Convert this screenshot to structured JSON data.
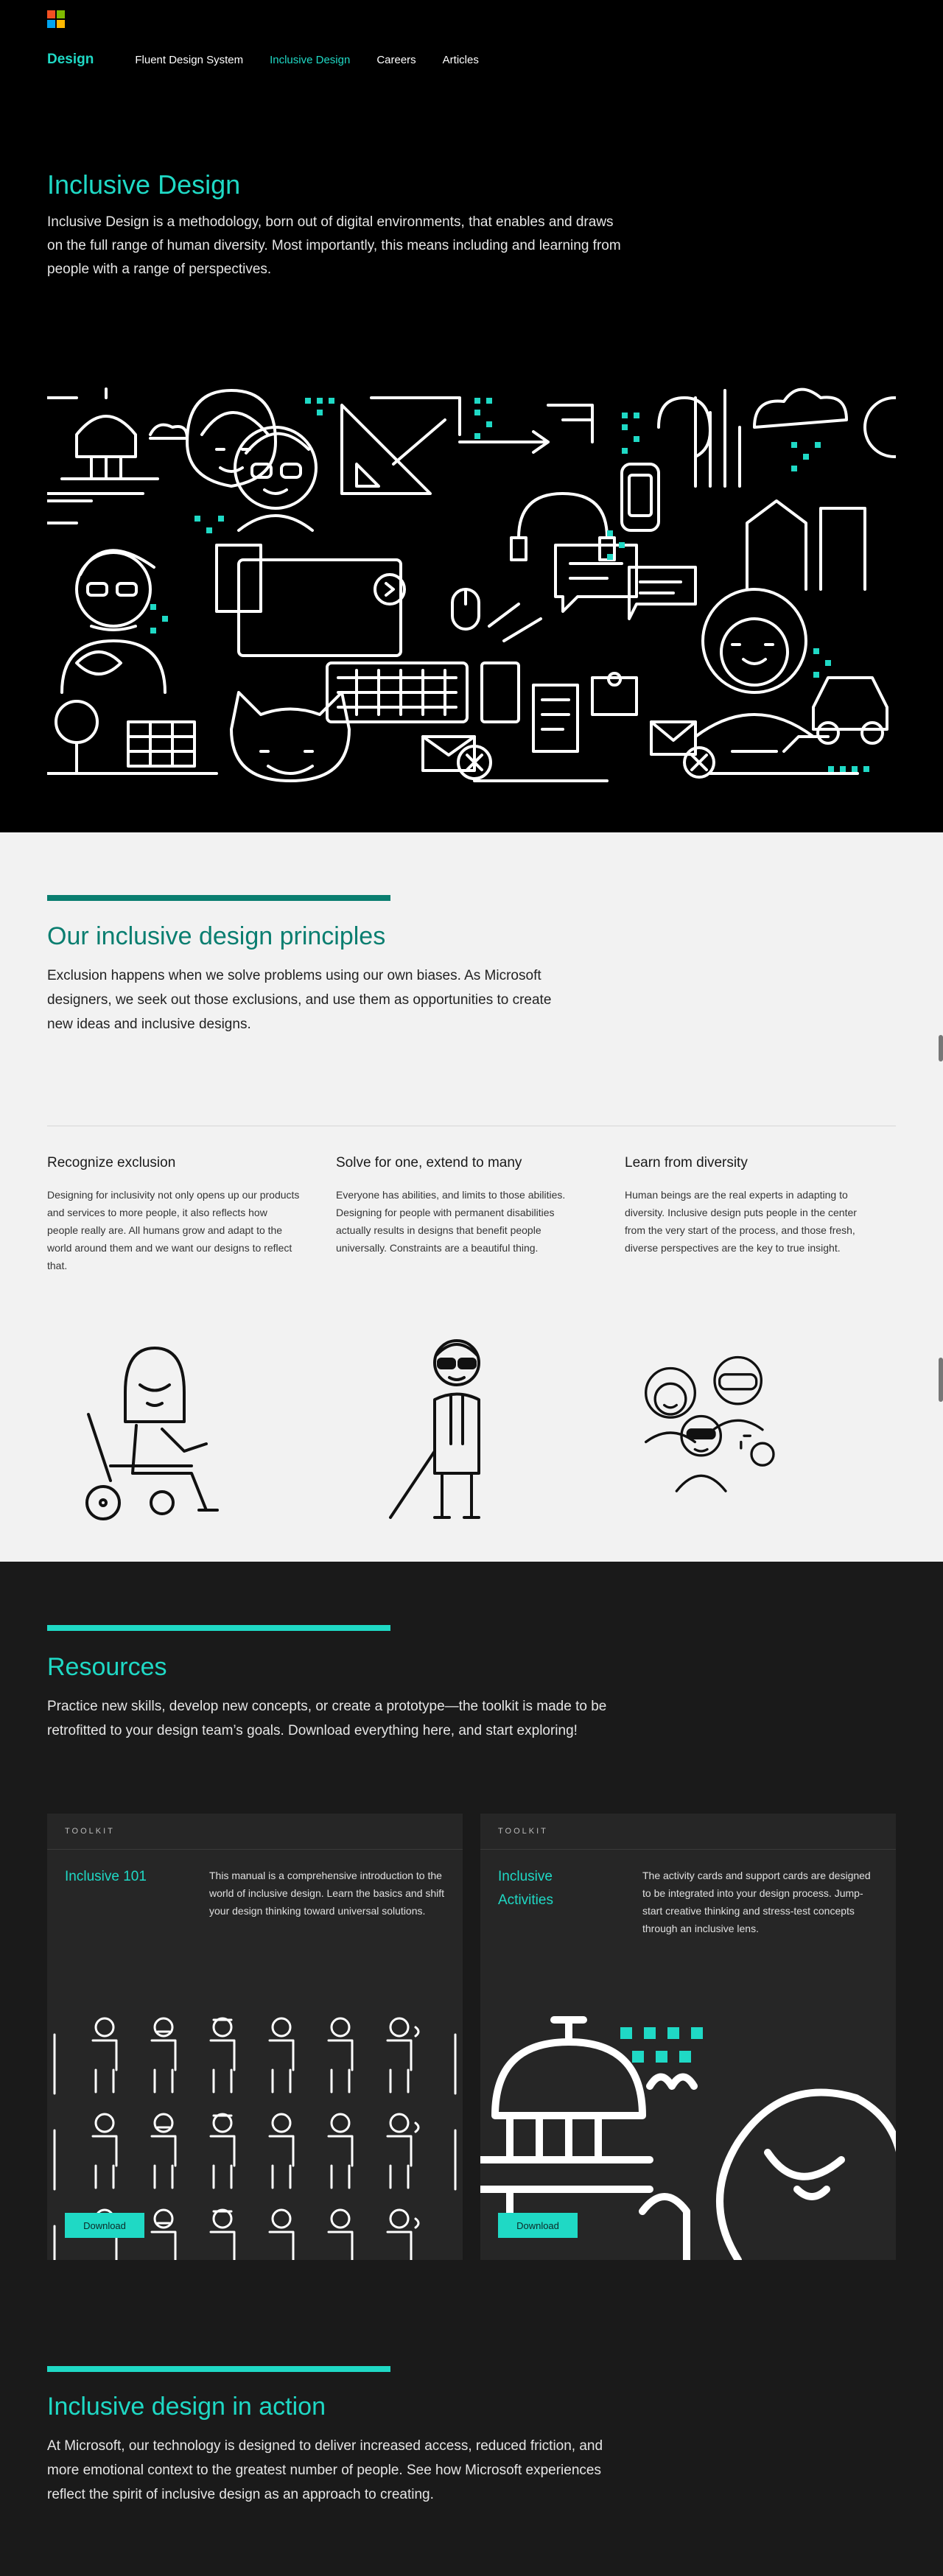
{
  "logo": {
    "colors": [
      "#f25022",
      "#7fba00",
      "#00a4ef",
      "#ffb900"
    ],
    "name": "microsoft-logo"
  },
  "nav": {
    "brand": "Design",
    "items": [
      {
        "label": "Fluent Design System",
        "active": false
      },
      {
        "label": "Inclusive Design",
        "active": true
      },
      {
        "label": "Careers",
        "active": false
      },
      {
        "label": "Articles",
        "active": false
      }
    ]
  },
  "hero": {
    "title": "Inclusive Design",
    "body": "Inclusive Design is a methodology, born out of digital environments, that enables and draws on the full range of human diversity. Most importantly, this means including and learning from people with a range of perspectives."
  },
  "principles": {
    "title": "Our inclusive design principles",
    "intro": "Exclusion happens when we solve problems using our own biases. As Microsoft designers, we seek out those exclusions, and use them as opportunities to create new ideas and inclusive designs.",
    "items": [
      {
        "title": "Recognize exclusion",
        "body": "Designing for inclusivity not only opens up our products and services to more people, it also reflects how people really are. All humans grow and adapt to the world around them and we want our designs to reflect that."
      },
      {
        "title": "Solve for one, extend to many",
        "body": "Everyone has abilities, and limits to those abilities. Designing for people with permanent disabilities actually results in designs that benefit people universally. Constraints are a beautiful thing."
      },
      {
        "title": "Learn from diversity",
        "body": "Human beings are the real experts in adapting to diversity. Inclusive design puts people in the center from the very start of the process, and those fresh, diverse perspectives are the key to true insight."
      }
    ]
  },
  "resources": {
    "title": "Resources",
    "intro": "Practice new skills, develop new concepts, or create a prototype—the toolkit is made to be retrofitted to your design team’s goals. Download everything here, and start exploring!",
    "cards": [
      {
        "kicker": "TOOLKIT",
        "title": "Inclusive 101",
        "body": "This manual is a comprehensive introduction to the world of inclusive design. Learn the basics and shift your design thinking toward universal solutions.",
        "button": "Download"
      },
      {
        "kicker": "TOOLKIT",
        "title": "Inclusive Activities",
        "body": "The activity cards and support cards are designed to be integrated into your design process. Jump-start creative thinking and stress-test concepts through an inclusive lens.",
        "button": "Download"
      }
    ]
  },
  "action": {
    "title": "Inclusive design in action",
    "body": "At Microsoft, our technology is designed to deliver increased access, reduced friction, and more emotional context to the greatest number of people. See how Microsoft experiences reflect the spirit of inclusive design as an approach to creating."
  },
  "colors": {
    "accent": "#1fd9c5",
    "accent_dark": "#0a7e70",
    "dark_bg": "#1a1a1a",
    "light_bg": "#f2f2f2"
  }
}
